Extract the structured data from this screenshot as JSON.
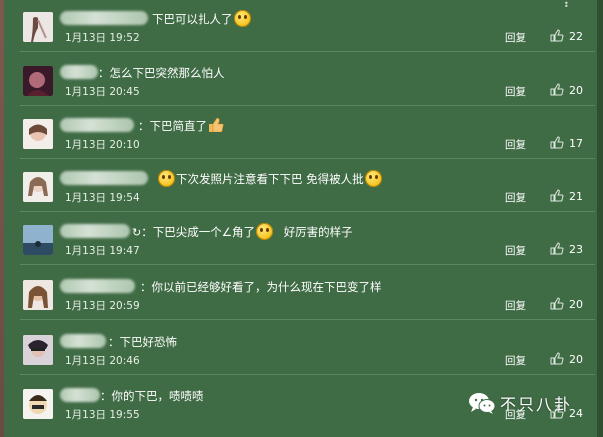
{
  "comments": [
    {
      "text": "下巴可以扎人了",
      "emoji_after": "laughing-emoji",
      "date": "1月13日 19:52",
      "reply": "回复",
      "likes": "22"
    },
    {
      "text": "：怎么下巴突然那么怕人",
      "date": "1月13日 20:45",
      "reply": "回复",
      "likes": "20"
    },
    {
      "text": "：下巴简直了",
      "emoji_after": "thumbs-up-emoji",
      "date": "1月13日 20:10",
      "reply": "回复",
      "likes": "17"
    },
    {
      "text": "下次发照片注意看下下巴 免得被人批",
      "date": "1月13日 19:54",
      "reply": "回复",
      "likes": "21"
    },
    {
      "text": "：下巴尖成一个∠角了",
      "text2": "好厉害的样子",
      "date": "1月13日 19:47",
      "reply": "回复",
      "likes": "23"
    },
    {
      "text": "：你以前已经够好看了，为什么现在下巴变了样",
      "date": "1月13日 20:59",
      "reply": "回复",
      "likes": "20"
    },
    {
      "text": "：下巴好恐怖",
      "date": "1月13日 20:46",
      "reply": "回复",
      "likes": "20"
    },
    {
      "text": "：你的下巴，啧啧啧",
      "date": "1月13日 19:55",
      "reply": "回复",
      "likes": "24"
    }
  ],
  "watermark": {
    "text": "不只八卦",
    "icon": "wechat-icon"
  },
  "colors": {
    "background": "#3f6b45",
    "divider": "#5d8663",
    "text": "#ffffff"
  }
}
